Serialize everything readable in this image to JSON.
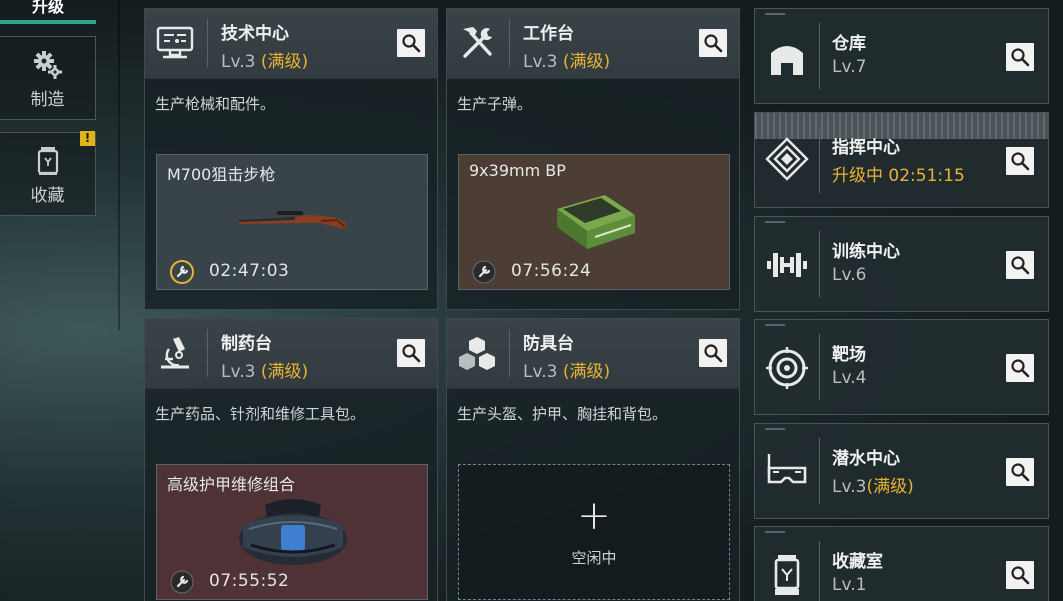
{
  "nav": {
    "active_label": "升级",
    "items": [
      {
        "label": "制造",
        "icon": "gear-icon"
      },
      {
        "label": "收藏",
        "icon": "collection-icon",
        "badge": "!"
      }
    ]
  },
  "stations": [
    {
      "title": "技术中心",
      "level": "Lv.3",
      "max_label": "(满级)",
      "icon": "computer-icon",
      "description": "生产枪械和配件。",
      "slot": {
        "product": "M700狙击步枪",
        "timer": "02:47:03",
        "timer_icon": "clock-wrench-icon",
        "art": "sniper-rifle"
      }
    },
    {
      "title": "工作台",
      "level": "Lv.3",
      "max_label": "(满级)",
      "icon": "hammer-wrench-icon",
      "description": "生产子弹。",
      "slot": {
        "product": "9x39mm BP",
        "timer": "07:56:24",
        "timer_icon": "wrench-icon",
        "art": "ammo-box"
      }
    },
    {
      "title": "制药台",
      "level": "Lv.3",
      "max_label": "(满级)",
      "icon": "microscope-icon",
      "description": "生产药品、针剂和维修工具包。",
      "slot": {
        "product": "高级护甲维修组合",
        "timer": "07:55:52",
        "timer_icon": "wrench-icon",
        "art": "repair-bag"
      }
    },
    {
      "title": "防具台",
      "level": "Lv.3",
      "max_label": "(满级)",
      "icon": "blocks-icon",
      "description": "生产头盔、护甲、胸挂和背包。",
      "slot": {
        "empty": true,
        "plus": "+",
        "idle_label": "空闲中"
      }
    }
  ],
  "facilities": [
    {
      "title": "仓库",
      "level": "Lv.7",
      "icon": "warehouse-icon"
    },
    {
      "title": "指挥中心",
      "level": "升级中 02:51:15",
      "upgrading": true,
      "icon": "command-icon"
    },
    {
      "title": "训练中心",
      "level": "Lv.6",
      "icon": "dumbbell-icon"
    },
    {
      "title": "靶场",
      "level": "Lv.4",
      "icon": "target-icon"
    },
    {
      "title": "潜水中心",
      "level": "Lv.3",
      "max_label": "(满级)",
      "icon": "diving-mask-icon"
    },
    {
      "title": "收藏室",
      "level": "Lv.1",
      "icon": "display-case-icon"
    }
  ],
  "colors": {
    "accent": "#2aa889",
    "max": "#e8b333",
    "badge": "#e3b31c",
    "button": "#f2f2f2"
  }
}
